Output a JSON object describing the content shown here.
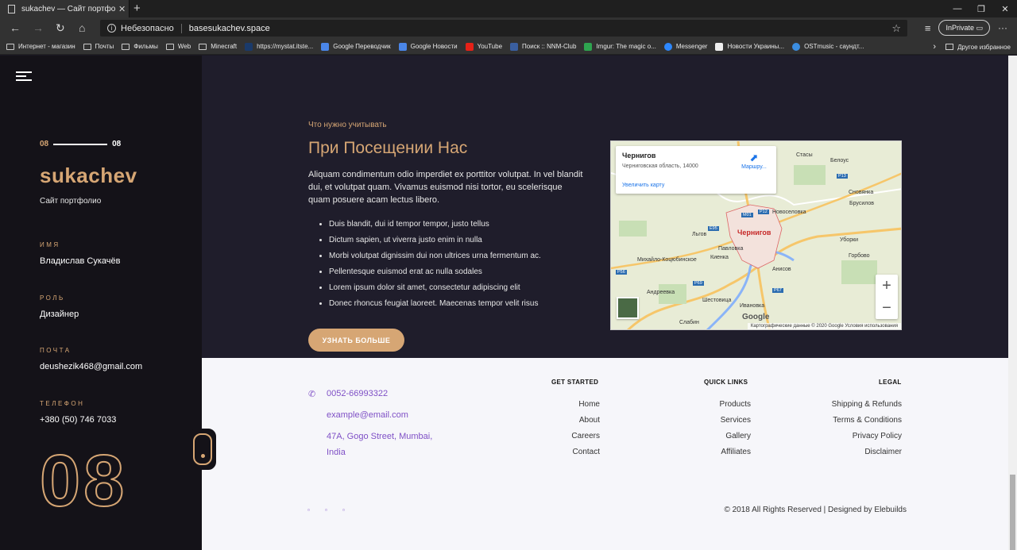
{
  "browser": {
    "tab_title": "sukachev — Сайт портфолио",
    "security": "Небезопасно",
    "url": "basesukachev.space",
    "inprivate": "InPrivate",
    "bookmarks": [
      "Интернет - магазин",
      "Почты",
      "Фильмы",
      "Web",
      "Minecraft",
      "https://mystat.itste...",
      "Google Переводчик",
      "Google Новости",
      "YouTube",
      "Поиск :: NNM-Club",
      "Imgur: The magic o...",
      "Messenger",
      "Новости Украины...",
      "OSTmusic - саундт..."
    ],
    "other_bookmarks": "Другое избранное"
  },
  "sidebar": {
    "counter_current": "08",
    "counter_total": "08",
    "brand": "sukachev",
    "subtitle": "Сайт портфолио",
    "name_label": "ИМЯ",
    "name_value": "Владислав Сукачёв",
    "role_label": "РОЛЬ",
    "role_value": "Дизайнер",
    "mail_label": "ПОЧТА",
    "mail_value": "deushezik468@gmail.com",
    "phone_label": "ТЕЛЕФОН",
    "phone_value": "+380 (50) 746 7033",
    "big_number": "08"
  },
  "hero": {
    "kicker": "Что нужно учитывать",
    "heading": "При Посещении Нас",
    "description": "Aliquam condimentum odio imperdiet ex porttitor volutpat. In vel blandit dui, et volutpat quam. Vivamus euismod nisi tortor, eu scelerisque quam posuere acam lectus libero.",
    "bullets": [
      "Duis blandit, dui id tempor tempor, justo tellus",
      "Dictum sapien, ut viverra justo enim in nulla",
      "Morbi volutpat dignissim dui non ultrices urna fermentum ac.",
      "Pellentesque euismod erat ac nulla sodales",
      "Lorem ipsum dolor sit amet, consectetur adipiscing elit",
      "Donec rhoncus feugiat laoreet. Maecenas tempor velit risus"
    ],
    "cta": "УЗНАТЬ БОЛЬШЕ"
  },
  "map": {
    "city": "Чернигов",
    "region": "Черниговская область, 14000",
    "route": "Маршру...",
    "enlarge": "Увеличить карту",
    "zoom_in": "+",
    "zoom_out": "−",
    "google": "Google",
    "attribution": "Картографические данные © 2020 Google   Условия использования",
    "labels": {
      "stasy": "Стасы",
      "belous": "Белоус",
      "novoselovka": "Новоселовка",
      "snovyanka": "Сновянка",
      "brusilov": "Брусилов",
      "lyugi": "Льгов",
      "kienka": "Киенка",
      "pavlovka": "Павловка",
      "mikhaylo": "Михайло-Коцюбинское",
      "anisov": "Анисов",
      "uborki": "Уборки",
      "gorobovo": "Горбово",
      "andreevka": "Андреевка",
      "shestovica": "Шестовица",
      "ivanovka": "Ивановка",
      "slabin": "Слабин",
      "city_main": "Чернигов"
    },
    "roads": [
      "P13",
      "P12",
      "E95",
      "M01",
      "P56",
      "P69",
      "P67"
    ]
  },
  "footer": {
    "phone": "0052-66993322",
    "email": "example@email.com",
    "address_line1": "47A, Gogo Street, Mumbai,",
    "address_line2": "India",
    "col1_title": "GET STARTED",
    "col1_links": [
      "Home",
      "About",
      "Careers",
      "Contact"
    ],
    "col2_title": "QUICK LINKS",
    "col2_links": [
      "Products",
      "Services",
      "Gallery",
      "Affiliates"
    ],
    "col3_title": "LEGAL",
    "col3_links": [
      "Shipping & Refunds",
      "Terms & Conditions",
      "Privacy Policy",
      "Disclaimer"
    ],
    "copyright": "© 2018 All Rights Reserved | Designed by Elebuilds"
  },
  "colors": {
    "accent": "#d6a674",
    "link": "#7f50c6",
    "sidebar_bg": "#141218",
    "hero_bg": "#1f1d2b"
  }
}
